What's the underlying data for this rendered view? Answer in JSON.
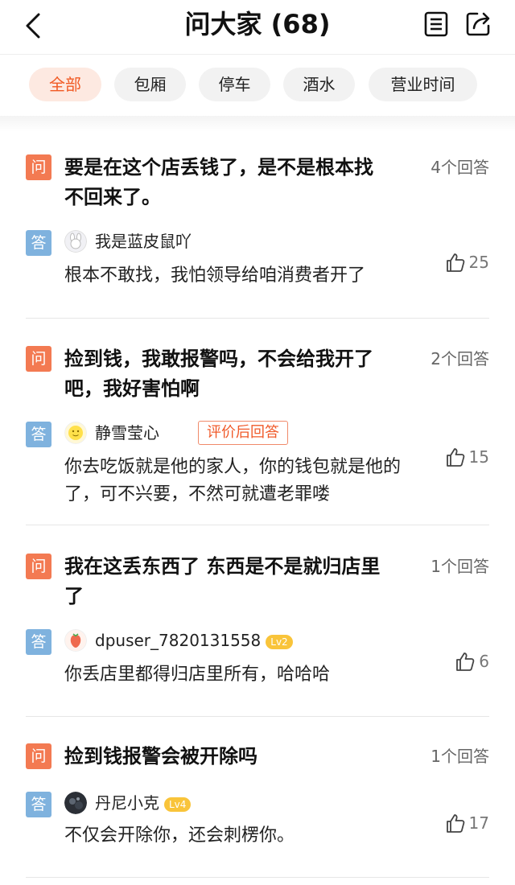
{
  "header": {
    "title": "问大家 (68)",
    "icons": {
      "back": "back-arrow-icon",
      "list": "list-icon",
      "share": "share-icon"
    }
  },
  "tabs": [
    "全部",
    "包厢",
    "停车",
    "酒水",
    "营业时间"
  ],
  "active_tab": "全部",
  "colors": {
    "accent": "#f15a24",
    "question_icon_bg": "#f37a52",
    "answer_icon_bg": "#7fb2de",
    "level_badge": "#f9c43a"
  },
  "qa": [
    {
      "q_label": "问",
      "question": "要是在这个店丢钱了，是不是根本找不回来了。",
      "answer_count": "4个回答",
      "a_label": "答",
      "user": "我是蓝皮鼠吖",
      "answer": "根本不敢找，我怕领导给咱消费者开了",
      "likes": "25"
    },
    {
      "q_label": "问",
      "question": "捡到钱，我敢报警吗，不会给我开了吧，我好害怕啊",
      "answer_count": "2个回答",
      "a_label": "答",
      "user": "静雪莹心",
      "badge": "评价后回答",
      "answer": "你去吃饭就是他的家人，你的钱包就是他的了，可不兴要，不然可就遭老罪喽",
      "likes": "15"
    },
    {
      "q_label": "问",
      "question": "我在这丢东西了 东西是不是就归店里了",
      "answer_count": "1个回答",
      "a_label": "答",
      "user": "dpuser_7820131558",
      "level": "Lv2",
      "answer": "你丢店里都得归店里所有，哈哈哈",
      "likes": "6"
    },
    {
      "q_label": "问",
      "question": "捡到钱报警会被开除吗",
      "answer_count": "1个回答",
      "a_label": "答",
      "user": "丹尼小克",
      "level": "Lv4",
      "answer": "不仅会开除你，还会刺楞你。",
      "likes": "17"
    }
  ]
}
